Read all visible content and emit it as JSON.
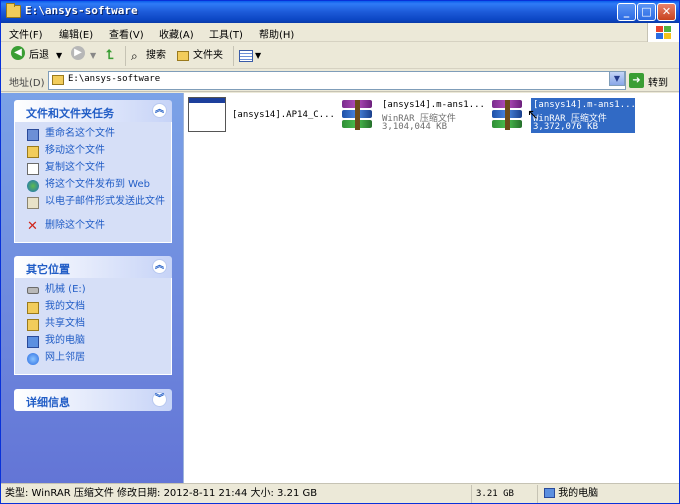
{
  "window": {
    "title": "E:\\ansys-software"
  },
  "menu": [
    {
      "label": "文件(F)"
    },
    {
      "label": "编辑(E)"
    },
    {
      "label": "查看(V)"
    },
    {
      "label": "收藏(A)"
    },
    {
      "label": "工具(T)"
    },
    {
      "label": "帮助(H)"
    }
  ],
  "toolbar": {
    "back_label": "后退",
    "search_label": "搜索",
    "folders_label": "文件夹"
  },
  "address": {
    "label": "地址(D)",
    "path": "E:\\ansys-software",
    "go_label": "转到"
  },
  "sidebar": {
    "file_tasks": {
      "title": "文件和文件夹任务",
      "items": [
        {
          "label": "重命名这个文件",
          "icon": "rename-icon"
        },
        {
          "label": "移动这个文件",
          "icon": "move-icon"
        },
        {
          "label": "复制这个文件",
          "icon": "copy-icon"
        },
        {
          "label": "将这个文件发布到 Web",
          "icon": "web-publish-icon"
        },
        {
          "label": "以电子邮件形式发送此文件",
          "icon": "email-icon"
        },
        {
          "label": "删除这个文件",
          "icon": "delete-icon"
        }
      ]
    },
    "other_places": {
      "title": "其它位置",
      "items": [
        {
          "label": "机械 (E:)",
          "icon": "drive-icon"
        },
        {
          "label": "我的文档",
          "icon": "my-documents-icon"
        },
        {
          "label": "共享文档",
          "icon": "shared-documents-icon"
        },
        {
          "label": "我的电脑",
          "icon": "my-computer-icon"
        },
        {
          "label": "网上邻居",
          "icon": "network-icon"
        }
      ]
    },
    "details": {
      "title": "详细信息"
    }
  },
  "files": [
    {
      "name": "[ansys14].AP14_C...",
      "type": "",
      "size": "",
      "icon": "program-window-icon",
      "selected": false
    },
    {
      "name": "[ansys14].m-ans1...",
      "type": "WinRAR 压缩文件",
      "size": "3,104,044 KB",
      "icon": "winrar-archive-icon",
      "selected": false
    },
    {
      "name": "[ansys14].m-ans1...",
      "type": "WinRAR 压缩文件",
      "size": "3,372,076 KB",
      "icon": "winrar-archive-icon",
      "selected": true
    }
  ],
  "status": {
    "info": "类型: WinRAR 压缩文件 修改日期: 2012-8-11 21:44 大小: 3.21 GB",
    "size": "3.21 GB",
    "location": "我的电脑"
  }
}
